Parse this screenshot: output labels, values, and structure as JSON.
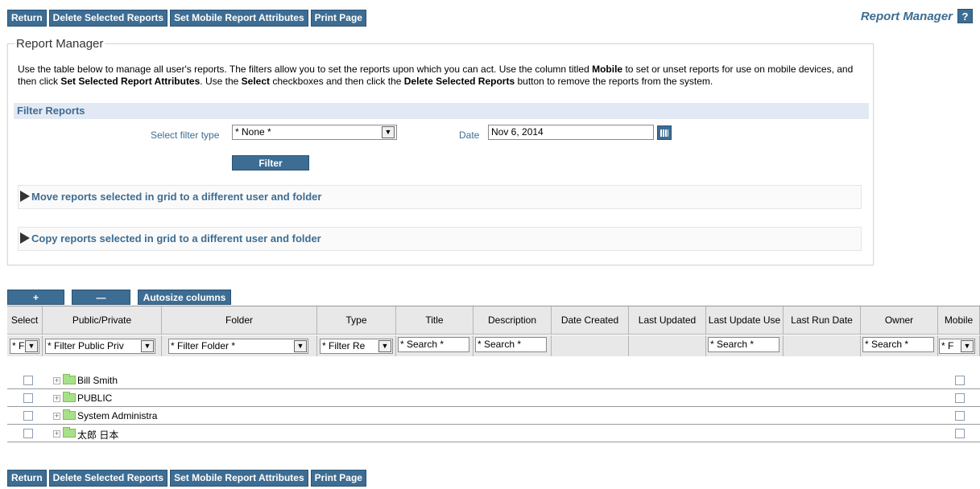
{
  "toolbar": {
    "return_label": "Return",
    "delete_label": "Delete Selected Reports",
    "mobile_label": "Set Mobile Report Attributes",
    "print_label": "Print Page"
  },
  "header": {
    "title": "Report Manager",
    "help_label": "?"
  },
  "panel": {
    "legend": "Report Manager",
    "desc_part1": "Use the table below to manage all user's reports. The filters allow you to set the reports upon which you can act. Use the column titled ",
    "desc_bold1": "Mobile",
    "desc_part2": " to set or unset reports for use on mobile devices, and then click ",
    "desc_bold2": "Set Selected Report Attributes",
    "desc_part3": ". Use the ",
    "desc_bold3": "Select",
    "desc_part4": " checkboxes and then click the ",
    "desc_bold4": "Delete Selected Reports",
    "desc_part5": " button to remove the reports from the system."
  },
  "filter": {
    "header": "Filter Reports",
    "type_label": "Select filter type",
    "type_value": "* None *",
    "date_label": "Date",
    "date_value": "Nov 6, 2014",
    "button_label": "Filter"
  },
  "collapsibles": {
    "move_label": "Move reports selected in grid to a different user and folder",
    "copy_label": "Copy reports selected in grid to a different user and folder"
  },
  "grid_toolbar": {
    "expand_label": "+",
    "collapse_label": "—",
    "autosize_label": "Autosize columns"
  },
  "grid": {
    "columns": [
      "Select",
      "Public/Private",
      "Folder",
      "Type",
      "Title",
      "Description",
      "Date Created",
      "Last Updated",
      "Last Update Use",
      "Last Run Date",
      "Owner",
      "Mobile"
    ],
    "filters": {
      "select": "* F",
      "public_private": "* Filter Public Priv",
      "folder": "* Filter Folder *",
      "type": "* Filter Re",
      "title": "* Search *",
      "description": "* Search *",
      "last_update_user": "* Search *",
      "owner": "* Search *",
      "mobile": "* F"
    },
    "rows": [
      {
        "folder": "Bill Smith"
      },
      {
        "folder": "PUBLIC"
      },
      {
        "folder": "System Administra"
      },
      {
        "folder": "太郎 日本"
      }
    ]
  }
}
